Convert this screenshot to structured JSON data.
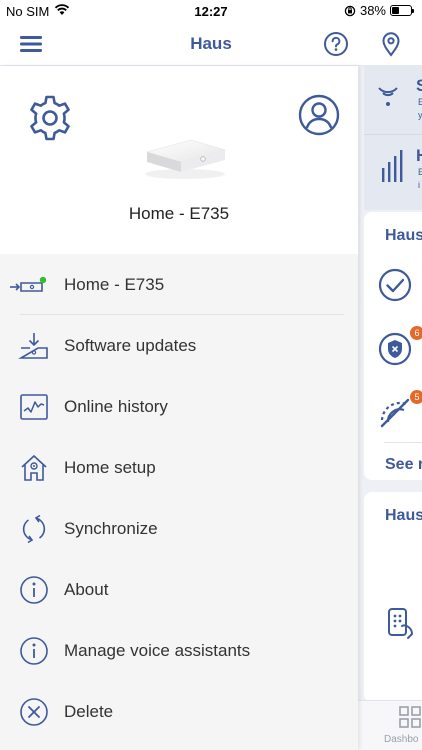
{
  "status_bar": {
    "carrier": "No SIM",
    "time": "12:27",
    "battery": "38%",
    "battery_level": 0.38
  },
  "nav": {
    "title": "Haus"
  },
  "drawer": {
    "device_name": "Home - E735",
    "menu": [
      {
        "label": "Home - E735",
        "icon": "gateway-connected-icon"
      },
      {
        "label": "Software updates",
        "icon": "download-update-icon"
      },
      {
        "label": "Online history",
        "icon": "chart-history-icon"
      },
      {
        "label": "Home setup",
        "icon": "home-setup-icon"
      },
      {
        "label": "Synchronize",
        "icon": "sync-icon"
      },
      {
        "label": "About",
        "icon": "info-icon"
      },
      {
        "label": "Manage voice assistants",
        "icon": "info-icon"
      },
      {
        "label": "Delete",
        "icon": "delete-circle-icon"
      }
    ]
  },
  "background": {
    "card1_title_partial": "S",
    "card1_sub_partial": "E\ny",
    "card2_title_partial": "H",
    "card2_sub_partial": "E\ni",
    "card3_title_partial": "Haus",
    "badge1": "6",
    "badge2": "5",
    "see_more_partial": "See r",
    "card4_title_partial": "Haus",
    "tab_partial": "Dashbo"
  },
  "colors": {
    "accent": "#3e5a9b",
    "badge": "#e46a2c",
    "online": "#2fc02f"
  }
}
